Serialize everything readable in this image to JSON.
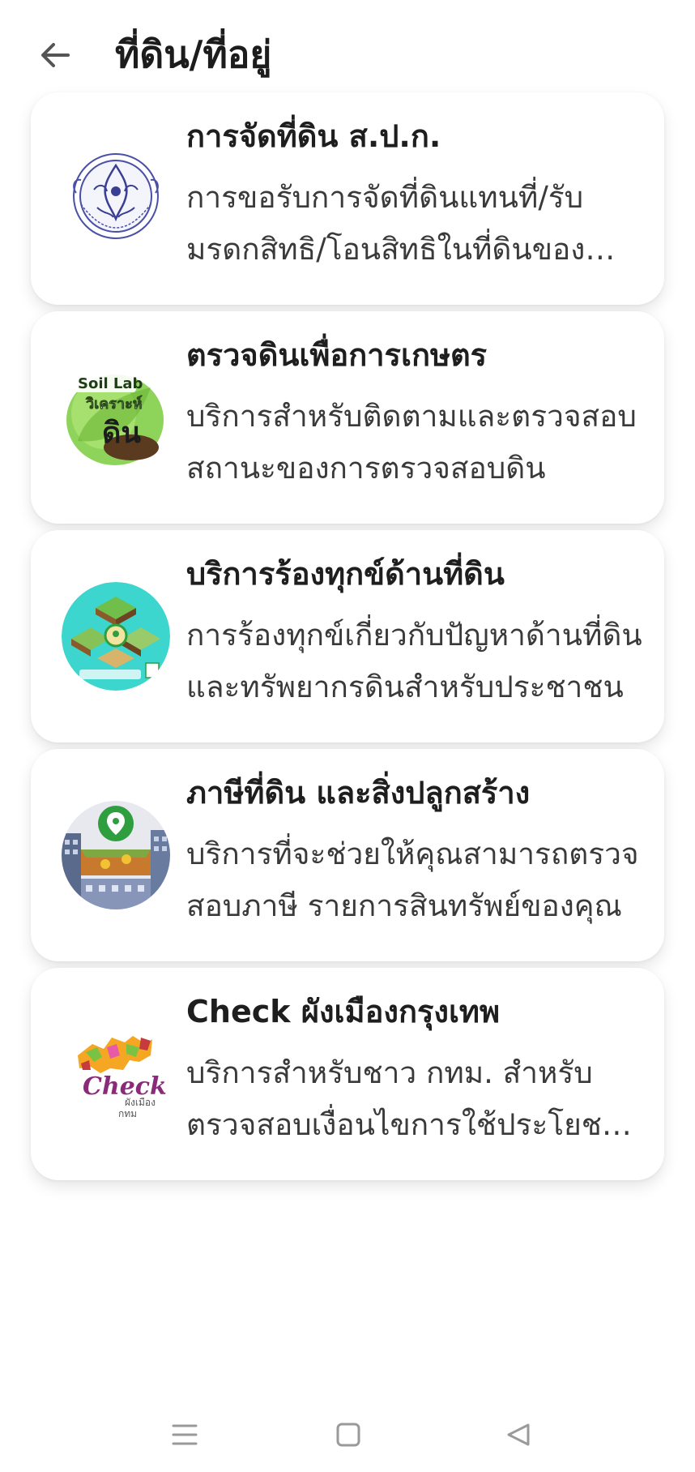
{
  "header": {
    "back_icon": "arrow-left-icon",
    "title": "ที่ดิน/ที่อยู่"
  },
  "services": [
    {
      "title": "การจัดที่ดิน ส.ป.ก.",
      "description": "การขอรับการจัดที่ดินแทนที่/รับมรดกสิทธิ/โอนสิทธิในที่ดินของเกษตรกร",
      "logo": "alro-seal-logo"
    },
    {
      "title": "ตรวจดินเพื่อการเกษตร",
      "description": "บริการสำหรับติดตามและตรวจสอบสถานะของการตรวจสอบดิน",
      "logo": "soil-lab-logo",
      "logo_text": {
        "line1": "Soil Lab",
        "line2": "วิเคราะห์",
        "line3": "ดิน"
      }
    },
    {
      "title": "บริการร้องทุกข์ด้านที่ดิน",
      "description": "การร้องทุกข์เกี่ยวกับปัญหาด้านที่ดินและทรัพยากรดินสำหรับประชาชน",
      "logo": "land-complaint-logo"
    },
    {
      "title": "ภาษีที่ดิน และสิ่งปลูกสร้าง",
      "description": "บริการที่จะช่วยให้คุณสามารถตรวจสอบภาษี รายการสินทรัพย์ของคุณ",
      "logo": "land-tax-logo"
    },
    {
      "title": "Check ผังเมืองกรุงเทพ",
      "description": "บริการสำหรับชาว กทม. สำหรับตรวจสอบเงื่อนไขการใช้ประโยชน์ที่ดิน",
      "logo": "check-city-plan-logo",
      "logo_text": {
        "line1": "Check",
        "line2": "ผังเมือง",
        "line3": "กทม"
      }
    }
  ],
  "nav": {
    "recent_icon": "menu-lines-icon",
    "home_icon": "square-icon",
    "back_icon": "triangle-back-icon"
  },
  "colors": {
    "background": "#ffffff",
    "title_text": "#1e1e1e",
    "body_text": "#3a3a3a",
    "nav_icon": "#9a9a9a",
    "soil_green": "#7cc242",
    "complaint_teal": "#3cd6cf",
    "map_pin_green": "#2e9e3f",
    "check_purple": "#8a2b7a",
    "map_orange": "#f5a623"
  }
}
